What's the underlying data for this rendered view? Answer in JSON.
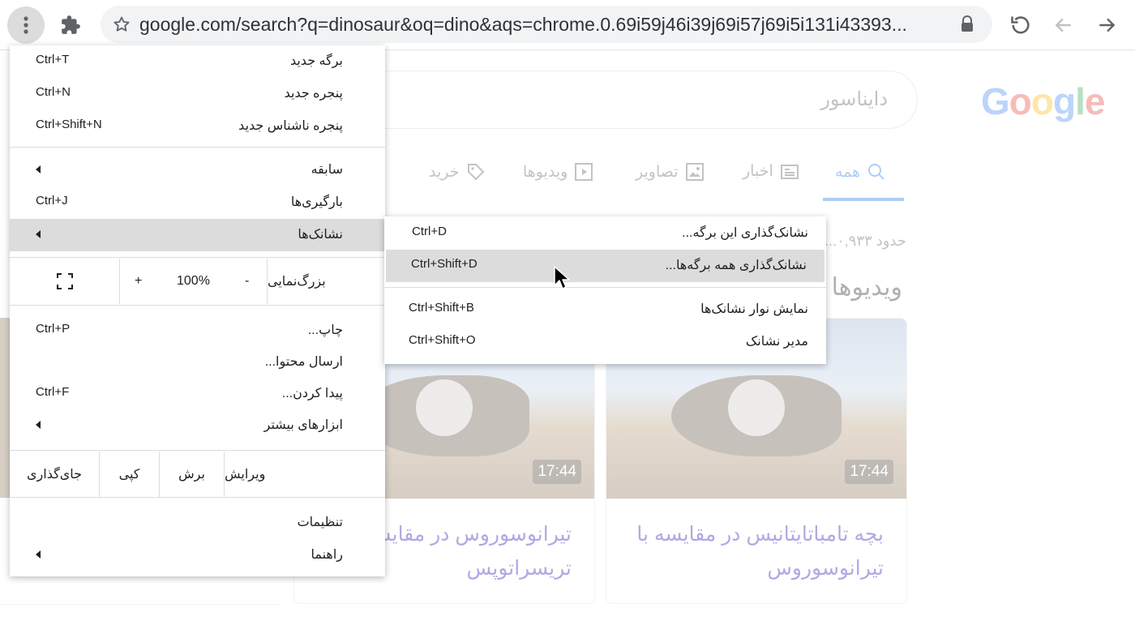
{
  "browser": {
    "url": "google.com/search?q=dinosaur&oq=dino&aqs=chrome.0.69i59j46i39j69i57j69i5i131i43393..."
  },
  "page": {
    "logo_letters": [
      {
        "ch": "G",
        "color": "#4285f4"
      },
      {
        "ch": "o",
        "color": "#ea4335"
      },
      {
        "ch": "o",
        "color": "#fbbc05"
      },
      {
        "ch": "g",
        "color": "#4285f4"
      },
      {
        "ch": "l",
        "color": "#34a853"
      },
      {
        "ch": "e",
        "color": "#ea4335"
      }
    ],
    "search_query": "دایناسور",
    "tabs": {
      "all": "همه",
      "news": "اخبار",
      "images": "تصاویر",
      "videos": "ویدیوها",
      "shopping": "خرید"
    },
    "results_count": "حدود ۰,۹۳۳...",
    "videos_heading": "ویدیوها",
    "videos": [
      {
        "duration": "17:44",
        "title": "بچه تامباتایتانیس در مقایسه با تیرانوسوروس"
      },
      {
        "duration": "17:44",
        "title": "تیرانوسوروس در مقایسه با تریسراتوپس"
      }
    ]
  },
  "menu": {
    "new_tab": {
      "label": "برگه جدید",
      "shortcut": "Ctrl+T"
    },
    "new_window": {
      "label": "پنجره جدید",
      "shortcut": "Ctrl+N"
    },
    "new_incognito": {
      "label": "پنجره ناشناس جدید",
      "shortcut": "Ctrl+Shift+N"
    },
    "history": {
      "label": "سابقه"
    },
    "downloads": {
      "label": "بارگیری‌ها",
      "shortcut": "Ctrl+J"
    },
    "bookmarks": {
      "label": "نشانک‌ها"
    },
    "zoom": {
      "label": "بزرگ‌نمایی",
      "minus": "-",
      "value": "100%",
      "plus": "+"
    },
    "print": {
      "label": "چاپ...",
      "shortcut": "Ctrl+P"
    },
    "cast": {
      "label": "ارسال محتوا..."
    },
    "find": {
      "label": "پیدا کردن...",
      "shortcut": "Ctrl+F"
    },
    "more_tools": {
      "label": "ابزارهای بیشتر"
    },
    "edit": {
      "label": "ویرایش",
      "cut": "برش",
      "copy": "کپی",
      "paste": "جای‌گذاری"
    },
    "settings": {
      "label": "تنظیمات"
    },
    "help": {
      "label": "راهنما"
    }
  },
  "submenu": {
    "bookmark_tab": {
      "label": "نشانک‌گذاری این برگه...",
      "shortcut": "Ctrl+D"
    },
    "bookmark_all": {
      "label": "نشانک‌گذاری همه برگه‌ها...",
      "shortcut": "Ctrl+Shift+D"
    },
    "show_bar": {
      "label": "نمایش نوار نشانک‌ها",
      "shortcut": "Ctrl+Shift+B"
    },
    "manager": {
      "label": "مدیر نشانک",
      "shortcut": "Ctrl+Shift+O"
    }
  },
  "colors": {
    "menu_highlight": "#dcdcdc",
    "accent": "#1a73e8"
  }
}
